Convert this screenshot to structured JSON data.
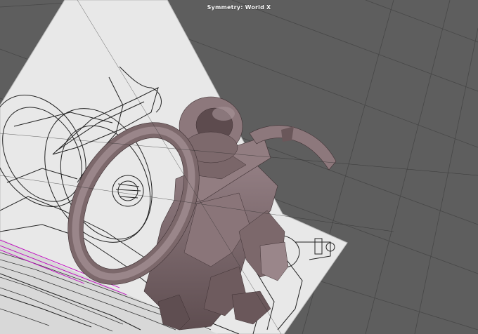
{
  "viewport": {
    "hud": {
      "symmetry_label": "Symmetry: World X"
    },
    "colors": {
      "background": "#5e5e5e",
      "grid_line": "#4a4a4a",
      "reference_sheet": "#e9e9e9",
      "blueprint_ink": "#1a1a1a",
      "mesh_surface": "#8b7779",
      "mesh_shadow": "#5b4a4c",
      "mesh_highlight": "#a8959a",
      "selection_edge": "#d000d0"
    },
    "icons": [
      "3d-viewport-icon"
    ]
  }
}
